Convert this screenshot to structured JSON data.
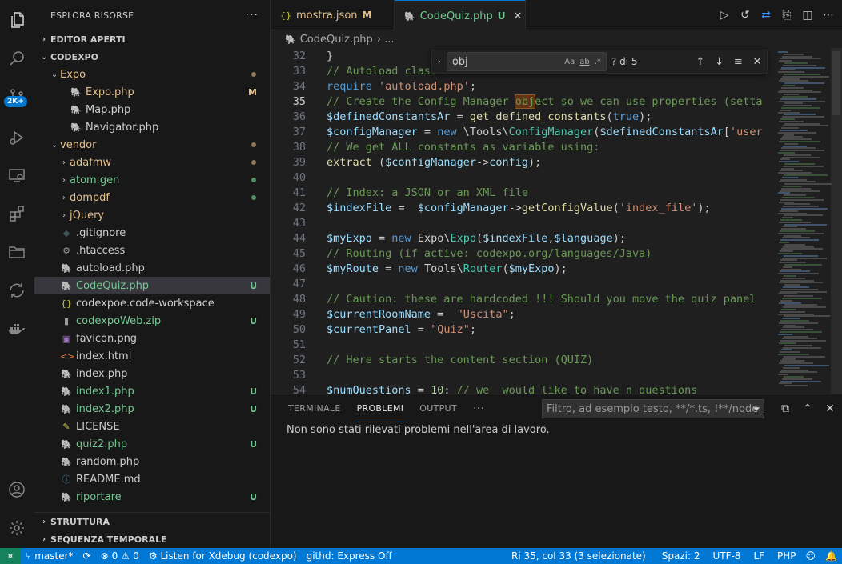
{
  "sidebar": {
    "title": "ESPLORA RISORSE",
    "more": "···",
    "editor_aperti": "EDITOR APERTI",
    "project": "CODEXPO",
    "items": [
      {
        "label": "Expo",
        "indent": 1,
        "chev": "⌄",
        "icon": "",
        "color": "c-mod",
        "deco": "dot-mod"
      },
      {
        "label": "Expo.php",
        "indent": 2,
        "chev": "",
        "icon": "php",
        "color": "c-mod",
        "deco": "M"
      },
      {
        "label": "Map.php",
        "indent": 2,
        "chev": "",
        "icon": "php",
        "color": "c-def",
        "deco": ""
      },
      {
        "label": "Navigator.php",
        "indent": 2,
        "chev": "",
        "icon": "php",
        "color": "c-def",
        "deco": ""
      },
      {
        "label": "vendor",
        "indent": 1,
        "chev": "⌄",
        "icon": "",
        "color": "c-mod",
        "deco": "dot-mod"
      },
      {
        "label": "adafmw",
        "indent": 2,
        "chev": "›",
        "icon": "",
        "color": "c-mod",
        "deco": "dot-mod"
      },
      {
        "label": "atom.gen",
        "indent": 2,
        "chev": "›",
        "icon": "",
        "color": "c-untr",
        "deco": "dot-untr"
      },
      {
        "label": "dompdf",
        "indent": 2,
        "chev": "›",
        "icon": "",
        "color": "c-mod",
        "deco": "dot-untr"
      },
      {
        "label": "jQuery",
        "indent": 2,
        "chev": "›",
        "icon": "",
        "color": "c-mod",
        "deco": ""
      },
      {
        "label": ".gitignore",
        "indent": 1,
        "chev": "",
        "icon": "git",
        "color": "c-def",
        "deco": ""
      },
      {
        "label": ".htaccess",
        "indent": 1,
        "chev": "",
        "icon": "gear",
        "color": "c-def",
        "deco": ""
      },
      {
        "label": "autoload.php",
        "indent": 1,
        "chev": "",
        "icon": "php",
        "color": "c-def",
        "deco": ""
      },
      {
        "label": "CodeQuiz.php",
        "indent": 1,
        "chev": "",
        "icon": "php",
        "color": "c-untr",
        "deco": "U",
        "selected": true
      },
      {
        "label": "codexpoe.code-workspace",
        "indent": 1,
        "chev": "",
        "icon": "json",
        "color": "c-def",
        "deco": ""
      },
      {
        "label": "codexpoWeb.zip",
        "indent": 1,
        "chev": "",
        "icon": "zip",
        "color": "c-untr",
        "deco": "U"
      },
      {
        "label": "favicon.png",
        "indent": 1,
        "chev": "",
        "icon": "img",
        "color": "c-def",
        "deco": ""
      },
      {
        "label": "index.html",
        "indent": 1,
        "chev": "",
        "icon": "html",
        "color": "c-def",
        "deco": ""
      },
      {
        "label": "index.php",
        "indent": 1,
        "chev": "",
        "icon": "php",
        "color": "c-def",
        "deco": ""
      },
      {
        "label": "index1.php",
        "indent": 1,
        "chev": "",
        "icon": "php",
        "color": "c-untr",
        "deco": "U"
      },
      {
        "label": "index2.php",
        "indent": 1,
        "chev": "",
        "icon": "php",
        "color": "c-untr",
        "deco": "U"
      },
      {
        "label": "LICENSE",
        "indent": 1,
        "chev": "",
        "icon": "license",
        "color": "c-def",
        "deco": ""
      },
      {
        "label": "quiz2.php",
        "indent": 1,
        "chev": "",
        "icon": "php",
        "color": "c-untr",
        "deco": "U"
      },
      {
        "label": "random.php",
        "indent": 1,
        "chev": "",
        "icon": "php",
        "color": "c-def",
        "deco": ""
      },
      {
        "label": "README.md",
        "indent": 1,
        "chev": "",
        "icon": "info",
        "color": "c-def",
        "deco": ""
      },
      {
        "label": "riportare",
        "indent": 1,
        "chev": "",
        "icon": "php",
        "color": "c-untr",
        "deco": "U"
      }
    ],
    "struttura": "STRUTTURA",
    "sequenza": "SEQUENZA TEMPORALE"
  },
  "activity": {
    "badge": "2K+"
  },
  "tabs": [
    {
      "label": "mostra.json",
      "deco": "M",
      "icon": "{}",
      "active": false
    },
    {
      "label": "CodeQuiz.php",
      "deco": "U",
      "icon": "php",
      "active": true,
      "close": "✕"
    }
  ],
  "breadcrumb": {
    "file": "CodeQuiz.php",
    "sep": "› ..."
  },
  "find": {
    "query": "obj",
    "count": "? di 5",
    "opt_case": "Aa",
    "opt_word": "ab",
    "opt_regex": ".*"
  },
  "editor": {
    "lines": [
      {
        "n": "32",
        "html": "}"
      },
      {
        "n": "33",
        "html": "<span class='cm'>// Autoload class</span>"
      },
      {
        "n": "34",
        "html": "<span class='kw'>require</span> <span class='st'>'autoload.php'</span>;"
      },
      {
        "n": "35",
        "cur": true,
        "html": "<span class='cm'>// Create the Config Manager <span class='hl'>obj</span>ect so we can use properties (setta</span>"
      },
      {
        "n": "36",
        "html": "<span class='vr'>$definedConstantsAr</span> = <span class='fn'>get_defined_constants</span>(<span class='kw'>true</span>);"
      },
      {
        "n": "37",
        "html": "<span class='vr'>$configManager</span> = <span class='kw'>new</span> \\Tools\\<span class='ty'>ConfigManager</span>(<span class='vr'>$definedConstantsAr</span>[<span class='st'>'user</span>"
      },
      {
        "n": "38",
        "html": "<span class='cm'>// We get ALL constants as variable using:</span>"
      },
      {
        "n": "39",
        "html": "<span class='fn'>extract</span> (<span class='vr'>$configManager</span>-><span class='vr'>config</span>);"
      },
      {
        "n": "40",
        "html": ""
      },
      {
        "n": "41",
        "html": "<span class='cm'>// Index: a JSON or an XML file</span>"
      },
      {
        "n": "42",
        "html": "<span class='vr'>$indexFile</span> =  <span class='vr'>$configManager</span>-><span class='fn'>getConfigValue</span>(<span class='st'>'index_file'</span>);"
      },
      {
        "n": "43",
        "html": ""
      },
      {
        "n": "44",
        "html": "<span class='vr'>$myExpo</span> = <span class='kw'>new</span> Expo\\<span class='ty'>Expo</span>(<span class='vr'>$indexFile</span>,<span class='vr'>$language</span>);"
      },
      {
        "n": "45",
        "html": "<span class='cm'>// Routing (if active: codexpo.org/languages/Java)</span>"
      },
      {
        "n": "46",
        "html": "<span class='vr'>$myRoute</span> = <span class='kw'>new</span> Tools\\<span class='ty'>Router</span>(<span class='vr'>$myExpo</span>);"
      },
      {
        "n": "47",
        "html": ""
      },
      {
        "n": "48",
        "html": "<span class='cm'>// Caution: these are hardcoded !!! Should you move the quiz panel</span>"
      },
      {
        "n": "49",
        "html": "<span class='vr'>$currentRoomName</span> =  <span class='st'>\"Uscita\"</span>;"
      },
      {
        "n": "50",
        "html": "<span class='vr'>$currentPanel</span> = <span class='st'>\"Quiz\"</span>;"
      },
      {
        "n": "51",
        "html": ""
      },
      {
        "n": "52",
        "html": "<span class='cm'>// Here starts the content section (QUIZ)</span>"
      },
      {
        "n": "53",
        "html": ""
      },
      {
        "n": "54",
        "html": "<span class='vr'>$numQuestions</span> = <span class='nu'>10</span>; <span class='cm'>// we  would like to have n questions</span>"
      }
    ]
  },
  "panel": {
    "tabs": [
      "TERMINALE",
      "PROBLEMI",
      "OUTPUT",
      "···"
    ],
    "active_tab": "PROBLEMI",
    "filter_placeholder": "Filtro, ad esempio testo, **/*.ts, !**/node_m...",
    "message": "Non sono stati rilevati problemi nell'area di lavoro."
  },
  "status": {
    "branch": "master*",
    "errors": "0",
    "warnings": "0",
    "xdebug": "Listen for Xdebug (codexpo)",
    "gitpod": "githd: Express Off",
    "position": "Ri 35, col 33 (3 selezionate)",
    "spaces": "Spazi: 2",
    "encoding": "UTF-8",
    "eol": "LF",
    "language": "PHP"
  },
  "colors": {
    "accent": "#0078d4",
    "modified": "#e2c08d",
    "untracked": "#73c991",
    "remote": "#16825d"
  }
}
